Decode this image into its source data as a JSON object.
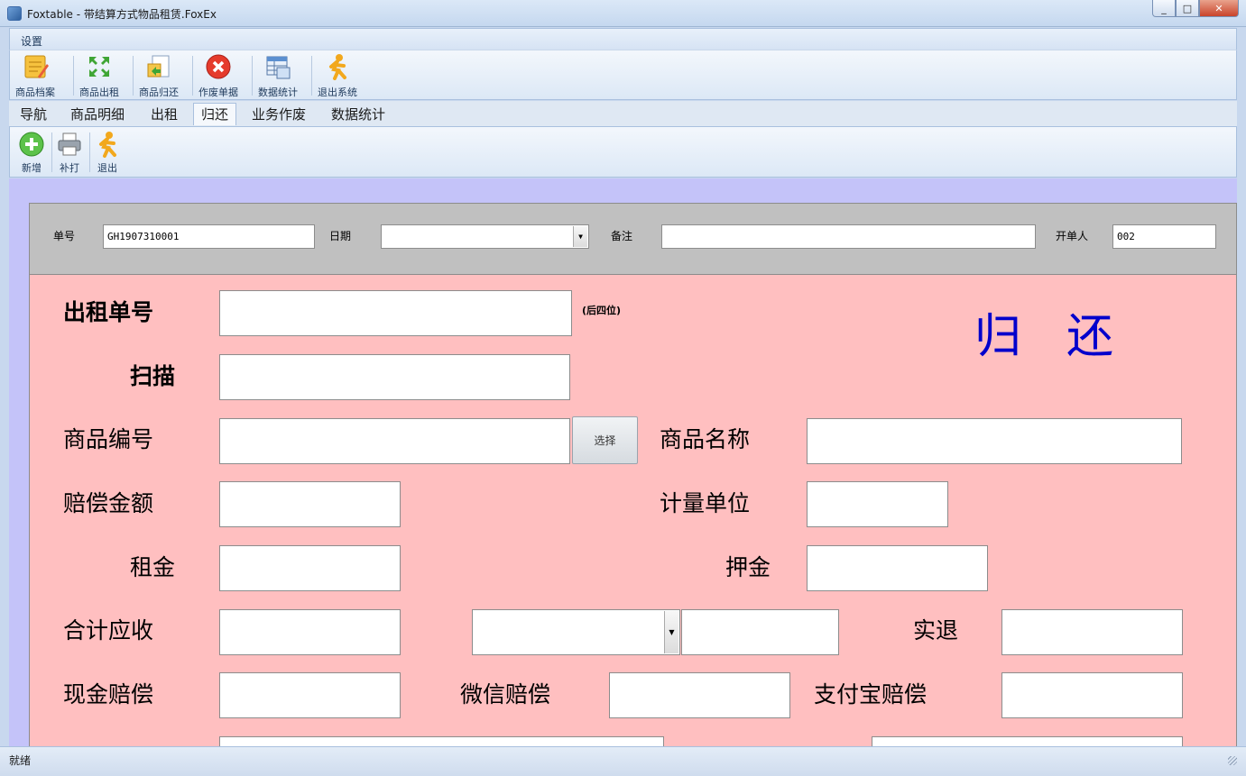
{
  "window": {
    "title": "Foxtable - 带结算方式物品租赁.FoxEx",
    "min_symbol": "_",
    "max_symbol": "□",
    "close_symbol": "✕"
  },
  "menu": {
    "settings": "设置"
  },
  "ribbon": [
    {
      "label": "商品档案",
      "icon": "notepad-icon"
    },
    {
      "label": "商品出租",
      "icon": "arrows-out-icon"
    },
    {
      "label": "商品归还",
      "icon": "return-document-icon"
    },
    {
      "label": "作废单据",
      "icon": "red-x-icon"
    },
    {
      "label": "数据统计",
      "icon": "spreadsheet-icon"
    },
    {
      "label": "退出系统",
      "icon": "running-man-icon"
    }
  ],
  "tabs": [
    {
      "label": "导航"
    },
    {
      "label": "商品明细"
    },
    {
      "label": "出租"
    },
    {
      "label": "归还",
      "active": true
    },
    {
      "label": "业务作废"
    },
    {
      "label": "数据统计"
    }
  ],
  "toolbar": [
    {
      "label": "新增",
      "icon": "green-plus-icon"
    },
    {
      "label": "补打",
      "icon": "printer-icon"
    },
    {
      "label": "退出",
      "icon": "running-man-icon"
    }
  ],
  "header": {
    "order_no_label": "单号",
    "order_no_value": "GH1907310001",
    "date_label": "日期",
    "date_value": "",
    "note_label": "备注",
    "note_value": "",
    "issuer_label": "开单人",
    "issuer_value": "002"
  },
  "form": {
    "title": "归还",
    "rental_no_label": "出租单号",
    "rental_no_hint": "(后四位)",
    "scan_label": "扫描",
    "product_code_label": "商品编号",
    "select_button": "选择",
    "product_name_label": "商品名称",
    "compensation_label": "赔偿金额",
    "unit_label": "计量单位",
    "rent_label": "租金",
    "deposit_label": "押金",
    "total_receivable_label": "合计应收",
    "actual_refund_label": "实退",
    "cash_comp_label": "现金赔偿",
    "wechat_comp_label": "微信赔偿",
    "alipay_comp_label": "支付宝赔偿"
  },
  "status": {
    "text": "就绪"
  },
  "colors": {
    "content_bg": "#c4c3f9",
    "header_panel_bg": "#c0c0c0",
    "form_bg": "#ffbfc0",
    "title_blue": "#0000cc"
  }
}
